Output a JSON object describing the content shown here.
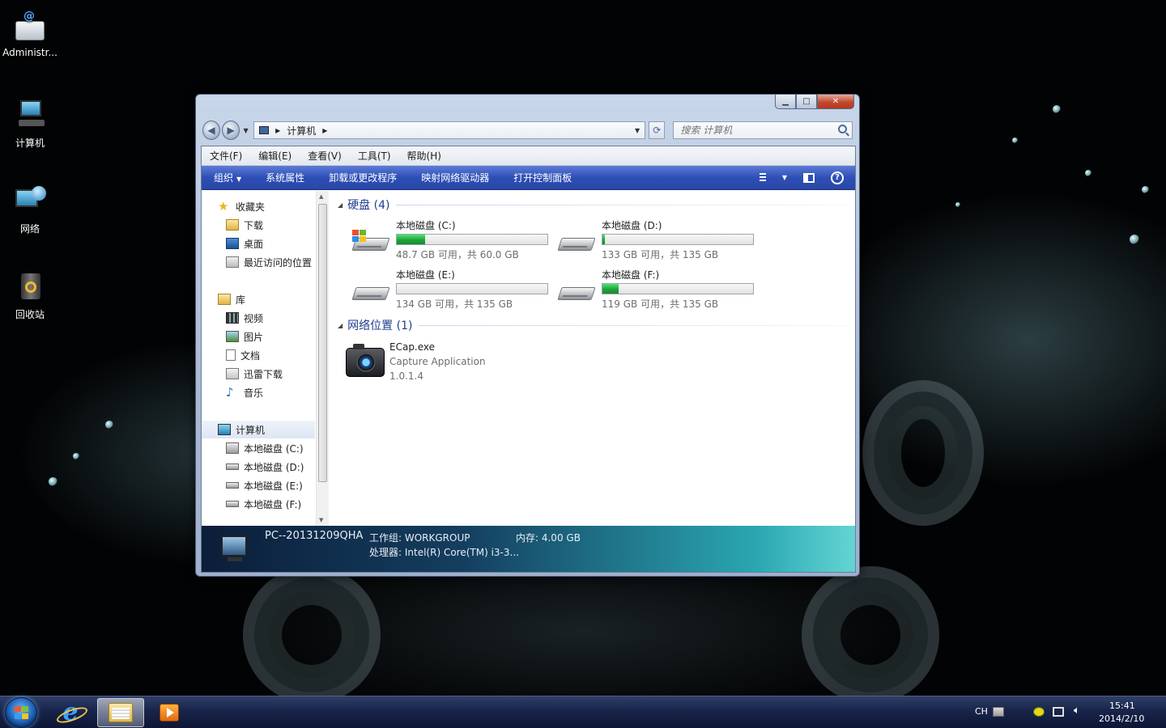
{
  "desktop": {
    "icons": [
      {
        "label": "Administr...",
        "icon": "user-folder-icon"
      },
      {
        "label": "计算机",
        "icon": "computer-icon"
      },
      {
        "label": "网络",
        "icon": "network-icon"
      },
      {
        "label": "回收站",
        "icon": "recycle-bin-icon"
      }
    ]
  },
  "window": {
    "address": {
      "crumb": "计算机",
      "crumb_icon": "computer-icon"
    },
    "search": {
      "placeholder": "搜索 计算机"
    },
    "menu": [
      "文件(F)",
      "编辑(E)",
      "查看(V)",
      "工具(T)",
      "帮助(H)"
    ],
    "commands": [
      "组织",
      "系统属性",
      "卸载或更改程序",
      "映射网络驱动器",
      "打开控制面板"
    ],
    "nav": {
      "favorites": {
        "label": "收藏夹",
        "items": [
          "下载",
          "桌面",
          "最近访问的位置"
        ]
      },
      "libraries": {
        "label": "库",
        "items": [
          "视频",
          "图片",
          "文档",
          "迅雷下载",
          "音乐"
        ]
      },
      "computer": {
        "label": "计算机",
        "items": [
          "本地磁盘 (C:)",
          "本地磁盘 (D:)",
          "本地磁盘 (E:)",
          "本地磁盘 (F:)"
        ]
      }
    },
    "groups": {
      "drives_header": "硬盘 (4)",
      "network_header": "网络位置 (1)"
    },
    "drives": [
      {
        "name": "本地磁盘 (C:)",
        "free": "48.7 GB 可用，共 60.0 GB",
        "used_fraction": 0.19,
        "system": true
      },
      {
        "name": "本地磁盘 (D:)",
        "free": "133 GB 可用，共 135 GB",
        "used_fraction": 0.015,
        "system": false
      },
      {
        "name": "本地磁盘 (E:)",
        "free": "134 GB 可用，共 135 GB",
        "used_fraction": 0.0,
        "system": false
      },
      {
        "name": "本地磁盘 (F:)",
        "free": "119 GB 可用，共 135 GB",
        "used_fraction": 0.11,
        "system": false
      }
    ],
    "network_item": {
      "name": "ECap.exe",
      "description": "Capture Application",
      "version": "1.0.1.4",
      "icon": "camera-icon"
    },
    "details": {
      "pc_name": "PC--20131209QHA",
      "workgroup": "工作组: WORKGROUP",
      "memory": "内存: 4.00 GB",
      "processor": "处理器: Intel(R) Core(TM) i3-3..."
    }
  },
  "taskbar": {
    "tray": {
      "lang": "CH",
      "time": "15:41",
      "date": "2014/2/10"
    }
  },
  "colors": {
    "accent": "#2d4fb6",
    "drive_fill": "#21a23c",
    "header_text": "#1e3e8f"
  }
}
